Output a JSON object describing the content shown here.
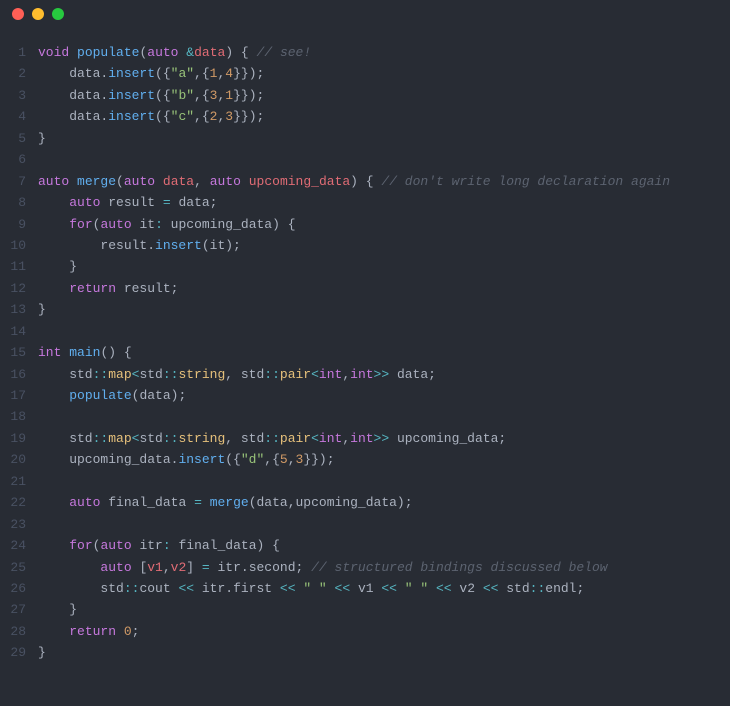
{
  "window": {
    "dots": [
      "red",
      "yellow",
      "green"
    ]
  },
  "code": {
    "lines": [
      {
        "n": 1,
        "tokens": [
          {
            "c": "tk-keyword",
            "t": "void"
          },
          {
            "c": "tk-plain",
            "t": " "
          },
          {
            "c": "tk-func",
            "t": "populate"
          },
          {
            "c": "tk-punc",
            "t": "("
          },
          {
            "c": "tk-keyword",
            "t": "auto"
          },
          {
            "c": "tk-plain",
            "t": " "
          },
          {
            "c": "tk-op",
            "t": "&"
          },
          {
            "c": "tk-param",
            "t": "data"
          },
          {
            "c": "tk-punc",
            "t": ") { "
          },
          {
            "c": "tk-comment",
            "t": "// see!"
          }
        ]
      },
      {
        "n": 2,
        "tokens": [
          {
            "c": "tk-plain",
            "t": "    data."
          },
          {
            "c": "tk-func",
            "t": "insert"
          },
          {
            "c": "tk-punc",
            "t": "({"
          },
          {
            "c": "tk-string",
            "t": "\"a\""
          },
          {
            "c": "tk-punc",
            "t": ",{"
          },
          {
            "c": "tk-number",
            "t": "1"
          },
          {
            "c": "tk-punc",
            "t": ","
          },
          {
            "c": "tk-number",
            "t": "4"
          },
          {
            "c": "tk-punc",
            "t": "}});"
          }
        ]
      },
      {
        "n": 3,
        "tokens": [
          {
            "c": "tk-plain",
            "t": "    data."
          },
          {
            "c": "tk-func",
            "t": "insert"
          },
          {
            "c": "tk-punc",
            "t": "({"
          },
          {
            "c": "tk-string",
            "t": "\"b\""
          },
          {
            "c": "tk-punc",
            "t": ",{"
          },
          {
            "c": "tk-number",
            "t": "3"
          },
          {
            "c": "tk-punc",
            "t": ","
          },
          {
            "c": "tk-number",
            "t": "1"
          },
          {
            "c": "tk-punc",
            "t": "}});"
          }
        ]
      },
      {
        "n": 4,
        "tokens": [
          {
            "c": "tk-plain",
            "t": "    data."
          },
          {
            "c": "tk-func",
            "t": "insert"
          },
          {
            "c": "tk-punc",
            "t": "({"
          },
          {
            "c": "tk-string",
            "t": "\"c\""
          },
          {
            "c": "tk-punc",
            "t": ",{"
          },
          {
            "c": "tk-number",
            "t": "2"
          },
          {
            "c": "tk-punc",
            "t": ","
          },
          {
            "c": "tk-number",
            "t": "3"
          },
          {
            "c": "tk-punc",
            "t": "}});"
          }
        ]
      },
      {
        "n": 5,
        "tokens": [
          {
            "c": "tk-punc",
            "t": "}"
          }
        ]
      },
      {
        "n": 6,
        "tokens": [
          {
            "c": "tk-plain",
            "t": ""
          }
        ]
      },
      {
        "n": 7,
        "tokens": [
          {
            "c": "tk-keyword",
            "t": "auto"
          },
          {
            "c": "tk-plain",
            "t": " "
          },
          {
            "c": "tk-func",
            "t": "merge"
          },
          {
            "c": "tk-punc",
            "t": "("
          },
          {
            "c": "tk-keyword",
            "t": "auto"
          },
          {
            "c": "tk-plain",
            "t": " "
          },
          {
            "c": "tk-param",
            "t": "data"
          },
          {
            "c": "tk-punc",
            "t": ", "
          },
          {
            "c": "tk-keyword",
            "t": "auto"
          },
          {
            "c": "tk-plain",
            "t": " "
          },
          {
            "c": "tk-param",
            "t": "upcoming_data"
          },
          {
            "c": "tk-punc",
            "t": ") { "
          },
          {
            "c": "tk-comment",
            "t": "// don't write long declaration again"
          }
        ]
      },
      {
        "n": 8,
        "tokens": [
          {
            "c": "tk-plain",
            "t": "    "
          },
          {
            "c": "tk-keyword",
            "t": "auto"
          },
          {
            "c": "tk-plain",
            "t": " result "
          },
          {
            "c": "tk-op",
            "t": "="
          },
          {
            "c": "tk-plain",
            "t": " data;"
          }
        ]
      },
      {
        "n": 9,
        "tokens": [
          {
            "c": "tk-plain",
            "t": "    "
          },
          {
            "c": "tk-keyword",
            "t": "for"
          },
          {
            "c": "tk-punc",
            "t": "("
          },
          {
            "c": "tk-keyword",
            "t": "auto"
          },
          {
            "c": "tk-plain",
            "t": " it"
          },
          {
            "c": "tk-op",
            "t": ":"
          },
          {
            "c": "tk-plain",
            "t": " upcoming_data) {"
          }
        ]
      },
      {
        "n": 10,
        "tokens": [
          {
            "c": "tk-plain",
            "t": "        result."
          },
          {
            "c": "tk-func",
            "t": "insert"
          },
          {
            "c": "tk-punc",
            "t": "(it);"
          }
        ]
      },
      {
        "n": 11,
        "tokens": [
          {
            "c": "tk-plain",
            "t": "    }"
          }
        ]
      },
      {
        "n": 12,
        "tokens": [
          {
            "c": "tk-plain",
            "t": "    "
          },
          {
            "c": "tk-keyword",
            "t": "return"
          },
          {
            "c": "tk-plain",
            "t": " result;"
          }
        ]
      },
      {
        "n": 13,
        "tokens": [
          {
            "c": "tk-punc",
            "t": "}"
          }
        ]
      },
      {
        "n": 14,
        "tokens": [
          {
            "c": "tk-plain",
            "t": ""
          }
        ]
      },
      {
        "n": 15,
        "tokens": [
          {
            "c": "tk-keyword",
            "t": "int"
          },
          {
            "c": "tk-plain",
            "t": " "
          },
          {
            "c": "tk-func",
            "t": "main"
          },
          {
            "c": "tk-punc",
            "t": "() {"
          }
        ]
      },
      {
        "n": 16,
        "tokens": [
          {
            "c": "tk-plain",
            "t": "    std"
          },
          {
            "c": "tk-op",
            "t": "::"
          },
          {
            "c": "tk-builtin",
            "t": "map"
          },
          {
            "c": "tk-op",
            "t": "<"
          },
          {
            "c": "tk-plain",
            "t": "std"
          },
          {
            "c": "tk-op",
            "t": "::"
          },
          {
            "c": "tk-builtin",
            "t": "string"
          },
          {
            "c": "tk-punc",
            "t": ", "
          },
          {
            "c": "tk-plain",
            "t": "std"
          },
          {
            "c": "tk-op",
            "t": "::"
          },
          {
            "c": "tk-builtin",
            "t": "pair"
          },
          {
            "c": "tk-op",
            "t": "<"
          },
          {
            "c": "tk-keyword",
            "t": "int"
          },
          {
            "c": "tk-punc",
            "t": ","
          },
          {
            "c": "tk-keyword",
            "t": "int"
          },
          {
            "c": "tk-op",
            "t": ">>"
          },
          {
            "c": "tk-plain",
            "t": " data;"
          }
        ]
      },
      {
        "n": 17,
        "tokens": [
          {
            "c": "tk-plain",
            "t": "    "
          },
          {
            "c": "tk-func",
            "t": "populate"
          },
          {
            "c": "tk-punc",
            "t": "(data);"
          }
        ]
      },
      {
        "n": 18,
        "tokens": [
          {
            "c": "tk-plain",
            "t": ""
          }
        ]
      },
      {
        "n": 19,
        "tokens": [
          {
            "c": "tk-plain",
            "t": "    std"
          },
          {
            "c": "tk-op",
            "t": "::"
          },
          {
            "c": "tk-builtin",
            "t": "map"
          },
          {
            "c": "tk-op",
            "t": "<"
          },
          {
            "c": "tk-plain",
            "t": "std"
          },
          {
            "c": "tk-op",
            "t": "::"
          },
          {
            "c": "tk-builtin",
            "t": "string"
          },
          {
            "c": "tk-punc",
            "t": ", "
          },
          {
            "c": "tk-plain",
            "t": "std"
          },
          {
            "c": "tk-op",
            "t": "::"
          },
          {
            "c": "tk-builtin",
            "t": "pair"
          },
          {
            "c": "tk-op",
            "t": "<"
          },
          {
            "c": "tk-keyword",
            "t": "int"
          },
          {
            "c": "tk-punc",
            "t": ","
          },
          {
            "c": "tk-keyword",
            "t": "int"
          },
          {
            "c": "tk-op",
            "t": ">>"
          },
          {
            "c": "tk-plain",
            "t": " upcoming_data;"
          }
        ]
      },
      {
        "n": 20,
        "tokens": [
          {
            "c": "tk-plain",
            "t": "    upcoming_data."
          },
          {
            "c": "tk-func",
            "t": "insert"
          },
          {
            "c": "tk-punc",
            "t": "({"
          },
          {
            "c": "tk-string",
            "t": "\"d\""
          },
          {
            "c": "tk-punc",
            "t": ",{"
          },
          {
            "c": "tk-number",
            "t": "5"
          },
          {
            "c": "tk-punc",
            "t": ","
          },
          {
            "c": "tk-number",
            "t": "3"
          },
          {
            "c": "tk-punc",
            "t": "}});"
          }
        ]
      },
      {
        "n": 21,
        "tokens": [
          {
            "c": "tk-plain",
            "t": ""
          }
        ]
      },
      {
        "n": 22,
        "tokens": [
          {
            "c": "tk-plain",
            "t": "    "
          },
          {
            "c": "tk-keyword",
            "t": "auto"
          },
          {
            "c": "tk-plain",
            "t": " final_data "
          },
          {
            "c": "tk-op",
            "t": "="
          },
          {
            "c": "tk-plain",
            "t": " "
          },
          {
            "c": "tk-func",
            "t": "merge"
          },
          {
            "c": "tk-punc",
            "t": "(data,upcoming_data);"
          }
        ]
      },
      {
        "n": 23,
        "tokens": [
          {
            "c": "tk-plain",
            "t": ""
          }
        ]
      },
      {
        "n": 24,
        "tokens": [
          {
            "c": "tk-plain",
            "t": "    "
          },
          {
            "c": "tk-keyword",
            "t": "for"
          },
          {
            "c": "tk-punc",
            "t": "("
          },
          {
            "c": "tk-keyword",
            "t": "auto"
          },
          {
            "c": "tk-plain",
            "t": " itr"
          },
          {
            "c": "tk-op",
            "t": ":"
          },
          {
            "c": "tk-plain",
            "t": " final_data) {"
          }
        ]
      },
      {
        "n": 25,
        "tokens": [
          {
            "c": "tk-plain",
            "t": "        "
          },
          {
            "c": "tk-keyword",
            "t": "auto"
          },
          {
            "c": "tk-plain",
            "t": " ["
          },
          {
            "c": "tk-var",
            "t": "v1"
          },
          {
            "c": "tk-punc",
            "t": ","
          },
          {
            "c": "tk-var",
            "t": "v2"
          },
          {
            "c": "tk-plain",
            "t": "] "
          },
          {
            "c": "tk-op",
            "t": "="
          },
          {
            "c": "tk-plain",
            "t": " itr.second; "
          },
          {
            "c": "tk-comment",
            "t": "// structured bindings discussed below"
          }
        ]
      },
      {
        "n": 26,
        "tokens": [
          {
            "c": "tk-plain",
            "t": "        std"
          },
          {
            "c": "tk-op",
            "t": "::"
          },
          {
            "c": "tk-plain",
            "t": "cout "
          },
          {
            "c": "tk-op",
            "t": "<<"
          },
          {
            "c": "tk-plain",
            "t": " itr.first "
          },
          {
            "c": "tk-op",
            "t": "<<"
          },
          {
            "c": "tk-plain",
            "t": " "
          },
          {
            "c": "tk-string",
            "t": "\" \""
          },
          {
            "c": "tk-plain",
            "t": " "
          },
          {
            "c": "tk-op",
            "t": "<<"
          },
          {
            "c": "tk-plain",
            "t": " v1 "
          },
          {
            "c": "tk-op",
            "t": "<<"
          },
          {
            "c": "tk-plain",
            "t": " "
          },
          {
            "c": "tk-string",
            "t": "\" \""
          },
          {
            "c": "tk-plain",
            "t": " "
          },
          {
            "c": "tk-op",
            "t": "<<"
          },
          {
            "c": "tk-plain",
            "t": " v2 "
          },
          {
            "c": "tk-op",
            "t": "<<"
          },
          {
            "c": "tk-plain",
            "t": " std"
          },
          {
            "c": "tk-op",
            "t": "::"
          },
          {
            "c": "tk-plain",
            "t": "endl;"
          }
        ]
      },
      {
        "n": 27,
        "tokens": [
          {
            "c": "tk-plain",
            "t": "    }"
          }
        ]
      },
      {
        "n": 28,
        "tokens": [
          {
            "c": "tk-plain",
            "t": "    "
          },
          {
            "c": "tk-keyword",
            "t": "return"
          },
          {
            "c": "tk-plain",
            "t": " "
          },
          {
            "c": "tk-number",
            "t": "0"
          },
          {
            "c": "tk-punc",
            "t": ";"
          }
        ]
      },
      {
        "n": 29,
        "tokens": [
          {
            "c": "tk-punc",
            "t": "}"
          }
        ]
      }
    ]
  }
}
